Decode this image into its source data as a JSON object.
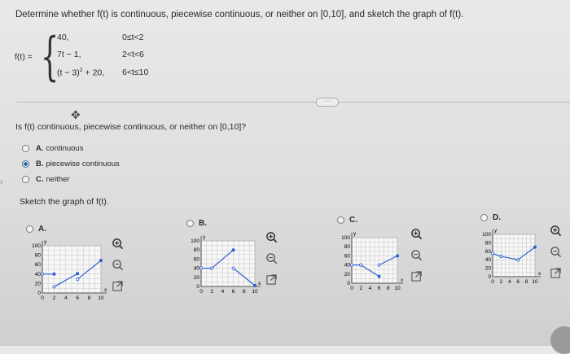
{
  "question": {
    "title": "Determine whether f(t) is continuous, piecewise continuous, or neither on [0,10], and sketch the graph of f(t).",
    "function_label": "f(t) =",
    "pieces": [
      {
        "expr": "40,",
        "cond": "0≤t<2"
      },
      {
        "expr": "7t − 1,",
        "cond": "2<t<6"
      },
      {
        "expr_base": "(t − 3)",
        "expr_exp": "2",
        "expr_tail": " + 20,",
        "cond": "6<t≤10"
      }
    ],
    "more_button": "·····",
    "prompt": "Is f(t) continuous, piecewise continuous, or neither on [0,10]?",
    "sketch_prompt": "Sketch the graph of f(t)."
  },
  "answer_options": [
    {
      "letter": "A.",
      "text": "continuous",
      "selected": false
    },
    {
      "letter": "B.",
      "text": "piecewise continuous",
      "selected": true
    },
    {
      "letter": "C.",
      "text": "neither",
      "selected": false
    }
  ],
  "graph_options": [
    {
      "letter": "A.",
      "selected": false
    },
    {
      "letter": "B.",
      "selected": false
    },
    {
      "letter": "C.",
      "selected": false
    },
    {
      "letter": "D.",
      "selected": false
    }
  ],
  "axis": {
    "y_letter": "y",
    "x_letter": "x",
    "y_ticks": [
      "100",
      "80",
      "60",
      "40",
      "20",
      "0"
    ],
    "x_ticks": [
      "0",
      "2",
      "4",
      "6",
      "8",
      "10"
    ]
  },
  "icons": [
    "zoom-in-icon",
    "zoom-out-icon",
    "expand-icon",
    "move-icon"
  ],
  "colors": {
    "curve": "#2f5fd0",
    "selected_radio": "#2f5f98",
    "grid": "#b9b9b9"
  }
}
